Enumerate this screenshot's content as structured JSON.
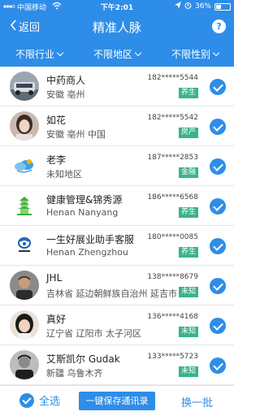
{
  "status": {
    "carrier": "中国移动",
    "time": "下午2:01",
    "battery": "36%",
    "battery_level": 0.36
  },
  "nav": {
    "back_label": "返回",
    "title": "精准人脉",
    "help_label": "?"
  },
  "filters": [
    {
      "label": "不限行业"
    },
    {
      "label": "不限地区"
    },
    {
      "label": "不限性别"
    }
  ],
  "contacts": [
    {
      "name": "中药商人",
      "location": "安徽 亳州",
      "phone": "182*****5544",
      "tag": "养生",
      "avatar": "car-avatar"
    },
    {
      "name": "如花",
      "location": "安徽 亳州 中国",
      "phone": "182*****5542",
      "tag": "房产",
      "avatar": "woman-avatar"
    },
    {
      "name": "老李",
      "location": "未知地区",
      "phone": "187*****2853",
      "tag": "金融",
      "avatar": "cloud-avatar"
    },
    {
      "name": "健康管理&锦秀源",
      "location": "Henan Nanyang",
      "phone": "186*****6568",
      "tag": "养生",
      "avatar": "pagoda-avatar"
    },
    {
      "name": "一生好展业助手客服",
      "location": "Henan Zhengzhou",
      "phone": "180*****0085",
      "tag": "养生",
      "avatar": "logo-avatar"
    },
    {
      "name": "JHL",
      "location": "吉林省 延边朝鲜族自治州 延吉市",
      "phone": "138*****8679",
      "tag": "未知",
      "avatar": "man-avatar"
    },
    {
      "name": "真好",
      "location": "辽宁省 辽阳市 太子河区",
      "phone": "136*****4168",
      "tag": "未知",
      "avatar": "girl-avatar"
    },
    {
      "name": "艾斯凯尔 Gudak",
      "location": "新疆 乌鲁木齐",
      "phone": "133*****5723",
      "tag": "未知",
      "avatar": "bw-man-avatar"
    }
  ],
  "footer": {
    "select_all": "全选",
    "save_contacts": "一键保存通讯录",
    "refresh": "换一批"
  },
  "colors": {
    "primary": "#2e8de8",
    "tag": "#3bb38a"
  }
}
